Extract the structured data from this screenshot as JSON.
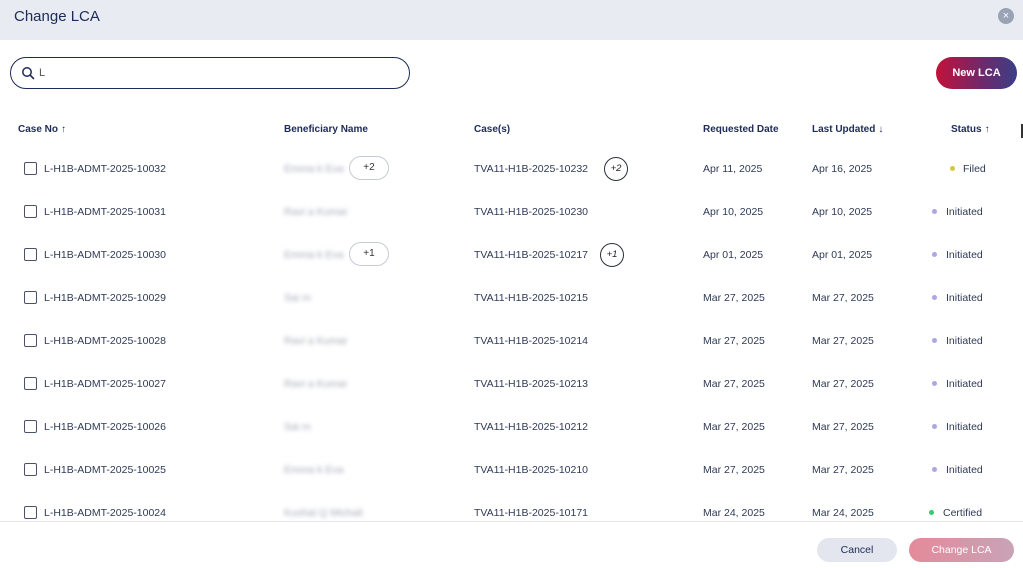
{
  "dialog": {
    "title": "Change LCA",
    "close_icon": "×"
  },
  "search": {
    "value": "L",
    "placeholder": ""
  },
  "new_lca_label": "New LCA",
  "table": {
    "headers": {
      "case_no": "Case No",
      "beneficiary": "Beneficiary Name",
      "cases": "Case(s)",
      "requested": "Requested Date",
      "updated": "Last Updated",
      "status": "Status"
    },
    "rows": [
      {
        "case_no": "L-H1B-ADMT-2025-10032",
        "beneficiary": "Emma k Eva",
        "ben_extra": "+2",
        "case": "TVA11-H1B-2025-10232",
        "case_extra": "+2",
        "requested": "Apr 11, 2025",
        "updated": "Apr 16, 2025",
        "status": "Filed",
        "status_color": "#d4c93a"
      },
      {
        "case_no": "L-H1B-ADMT-2025-10031",
        "beneficiary": "Ravi a Kumar",
        "ben_extra": "",
        "case": "TVA11-H1B-2025-10230",
        "case_extra": "",
        "requested": "Apr 10, 2025",
        "updated": "Apr 10, 2025",
        "status": "Initiated",
        "status_color": "#a9a8e6"
      },
      {
        "case_no": "L-H1B-ADMT-2025-10030",
        "beneficiary": "Emma k Eva",
        "ben_extra": "+1",
        "case": "TVA11-H1B-2025-10217",
        "case_extra": "+1",
        "requested": "Apr 01, 2025",
        "updated": "Apr 01, 2025",
        "status": "Initiated",
        "status_color": "#a9a8e6"
      },
      {
        "case_no": "L-H1B-ADMT-2025-10029",
        "beneficiary": "Sai m",
        "ben_extra": "",
        "case": "TVA11-H1B-2025-10215",
        "case_extra": "",
        "requested": "Mar 27, 2025",
        "updated": "Mar 27, 2025",
        "status": "Initiated",
        "status_color": "#a9a8e6"
      },
      {
        "case_no": "L-H1B-ADMT-2025-10028",
        "beneficiary": "Ravi a Kumar",
        "ben_extra": "",
        "case": "TVA11-H1B-2025-10214",
        "case_extra": "",
        "requested": "Mar 27, 2025",
        "updated": "Mar 27, 2025",
        "status": "Initiated",
        "status_color": "#a9a8e6"
      },
      {
        "case_no": "L-H1B-ADMT-2025-10027",
        "beneficiary": "Ravi a Kumar",
        "ben_extra": "",
        "case": "TVA11-H1B-2025-10213",
        "case_extra": "",
        "requested": "Mar 27, 2025",
        "updated": "Mar 27, 2025",
        "status": "Initiated",
        "status_color": "#a9a8e6"
      },
      {
        "case_no": "L-H1B-ADMT-2025-10026",
        "beneficiary": "Sai m",
        "ben_extra": "",
        "case": "TVA11-H1B-2025-10212",
        "case_extra": "",
        "requested": "Mar 27, 2025",
        "updated": "Mar 27, 2025",
        "status": "Initiated",
        "status_color": "#a9a8e6"
      },
      {
        "case_no": "L-H1B-ADMT-2025-10025",
        "beneficiary": "Emma k Eva",
        "ben_extra": "",
        "case": "TVA11-H1B-2025-10210",
        "case_extra": "",
        "requested": "Mar 27, 2025",
        "updated": "Mar 27, 2025",
        "status": "Initiated",
        "status_color": "#a9a8e6"
      },
      {
        "case_no": "L-H1B-ADMT-2025-10024",
        "beneficiary": "Kushal Q Michali",
        "ben_extra": "",
        "case": "TVA11-H1B-2025-10171",
        "case_extra": "",
        "requested": "Mar 24, 2025",
        "updated": "Mar 24, 2025",
        "status": "Certified",
        "status_color": "#2ecc71"
      }
    ]
  },
  "footer": {
    "cancel_label": "Cancel",
    "change_label": "Change LCA"
  }
}
